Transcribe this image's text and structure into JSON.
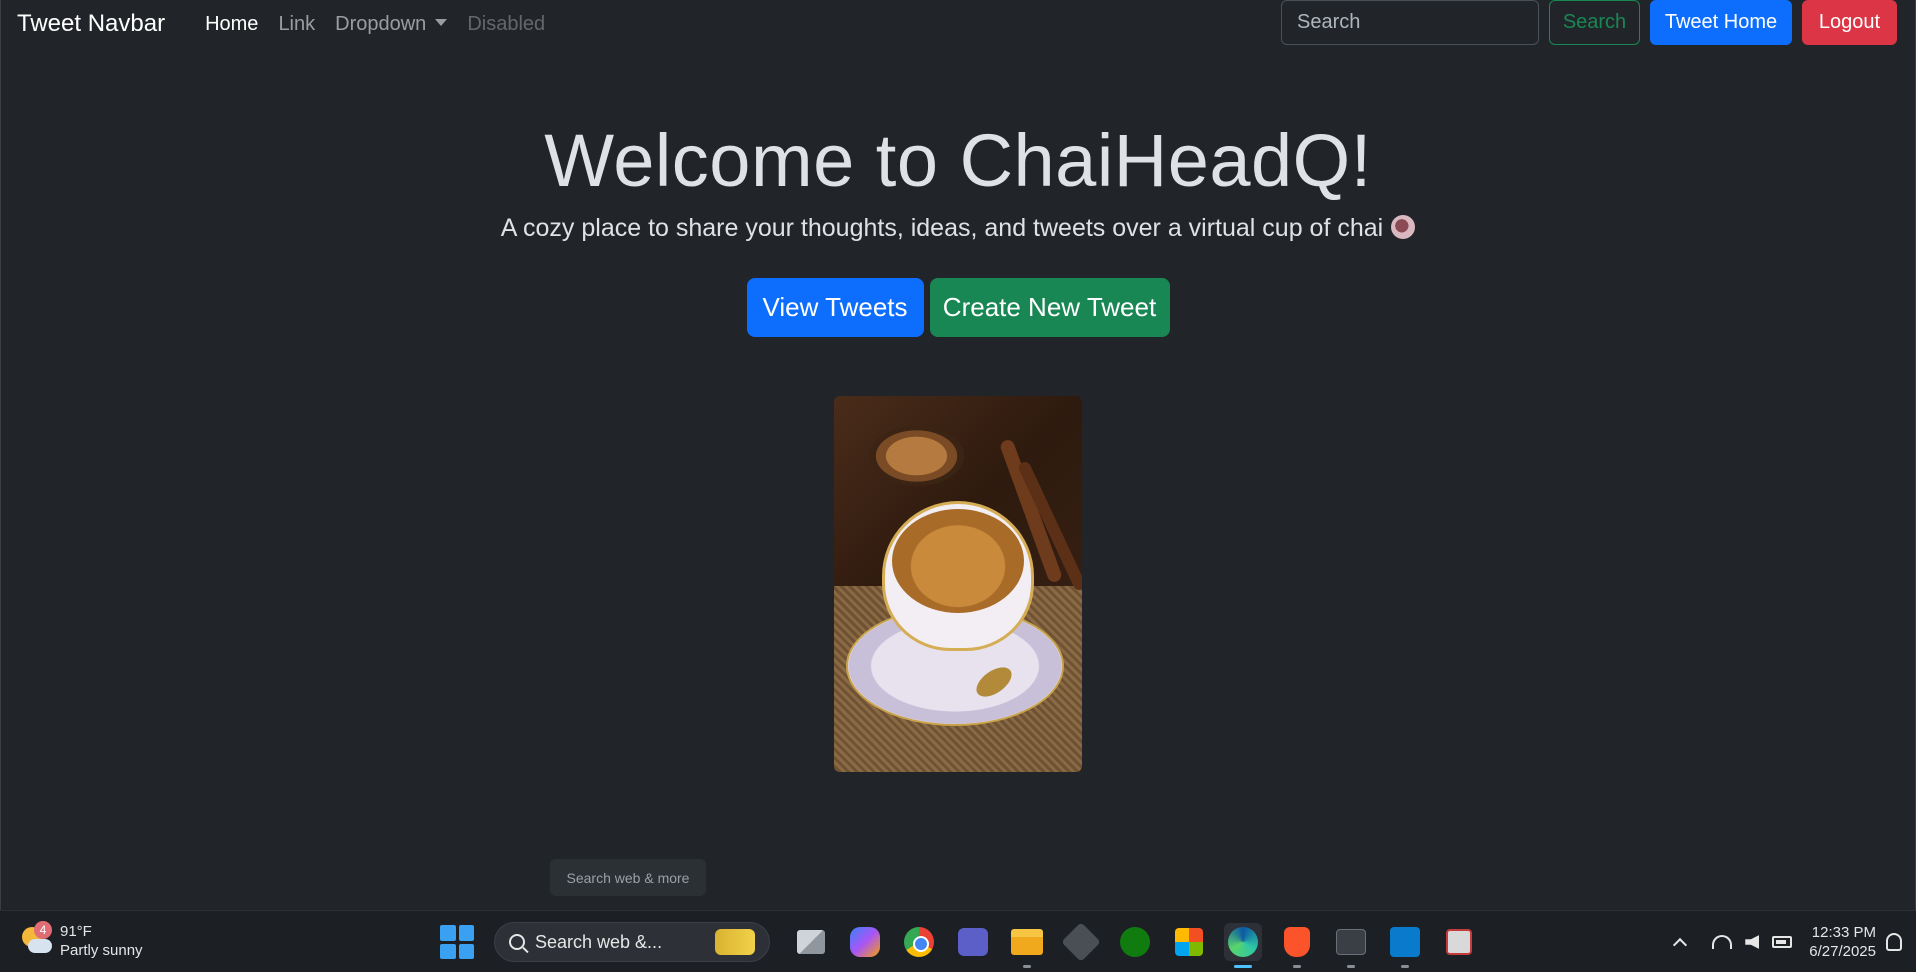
{
  "navbar": {
    "brand": "Tweet Navbar",
    "links": [
      {
        "label": "Home"
      },
      {
        "label": "Link"
      },
      {
        "label": "Dropdown"
      },
      {
        "label": "Disabled"
      }
    ],
    "search_placeholder": "Search",
    "search_button": "Search",
    "tweet_home_button": "Tweet Home",
    "logout_button": "Logout"
  },
  "hero": {
    "title": "Welcome to ChaiHeadQ!",
    "subtitle": "A cozy place to share your thoughts, ideas, and tweets over a virtual cup of chai",
    "view_button": "View Tweets",
    "create_button": "Create New Tweet"
  },
  "edge_search": {
    "text": "Search web & more"
  },
  "taskbar": {
    "weather": {
      "badge": "4",
      "temp": "91°F",
      "condition": "Partly sunny"
    },
    "search_text": "Search web &...",
    "clock": {
      "time": "12:33 PM",
      "date": "6/27/2025"
    }
  },
  "colors": {
    "background": "#212529",
    "primary": "#0d6efd",
    "success": "#198754",
    "danger": "#dc3545"
  }
}
